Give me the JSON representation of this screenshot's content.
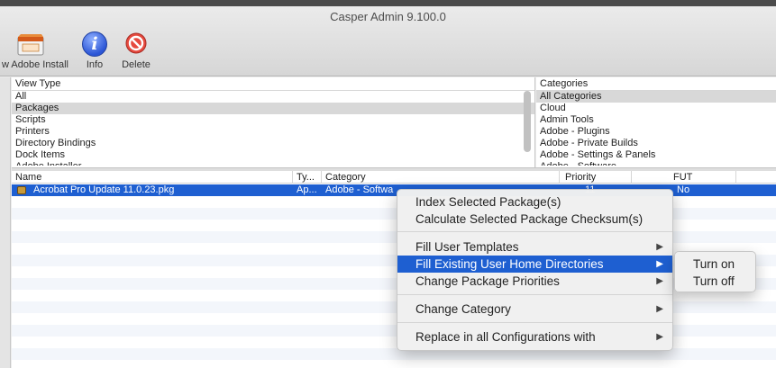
{
  "window": {
    "title": "Casper Admin 9.100.0"
  },
  "toolbar": {
    "adobe_label": "w Adobe Install",
    "info_label": "Info",
    "delete_label": "Delete"
  },
  "view_type": {
    "header": "View Type",
    "items": [
      "All",
      "Packages",
      "Scripts",
      "Printers",
      "Directory Bindings",
      "Dock Items",
      "Adobe Installer"
    ],
    "selected": "Packages"
  },
  "categories": {
    "header": "Categories",
    "items": [
      "All Categories",
      "Cloud",
      "Admin Tools",
      "Adobe - Plugins",
      "Adobe - Private Builds",
      "Adobe - Settings & Panels",
      "Adobe - Software"
    ],
    "selected": "All Categories"
  },
  "table": {
    "columns": [
      "Name",
      "Ty...",
      "Category",
      "Priority",
      "FUT"
    ],
    "rows": [
      {
        "name": "Acrobat Pro Update 11.0.23.pkg",
        "type": "Ap...",
        "category": "Adobe - Softwa",
        "priority": "11",
        "fut": "No"
      }
    ]
  },
  "context_menu": {
    "items": [
      {
        "label": "Index Selected Package(s)",
        "submenu": false
      },
      {
        "label": "Calculate Selected Package Checksum(s)",
        "submenu": false
      },
      {
        "label": "Fill User Templates",
        "submenu": true
      },
      {
        "label": "Fill Existing User Home Directories",
        "submenu": true,
        "highlighted": true
      },
      {
        "label": "Change Package Priorities",
        "submenu": true
      },
      {
        "label": "Change Category",
        "submenu": true
      },
      {
        "label": "Replace in all Configurations with",
        "submenu": true
      }
    ],
    "submenu_items": [
      "Turn on",
      "Turn off"
    ]
  },
  "colors": {
    "selection": "#1e5fd1",
    "accent": "#2c56d6"
  }
}
